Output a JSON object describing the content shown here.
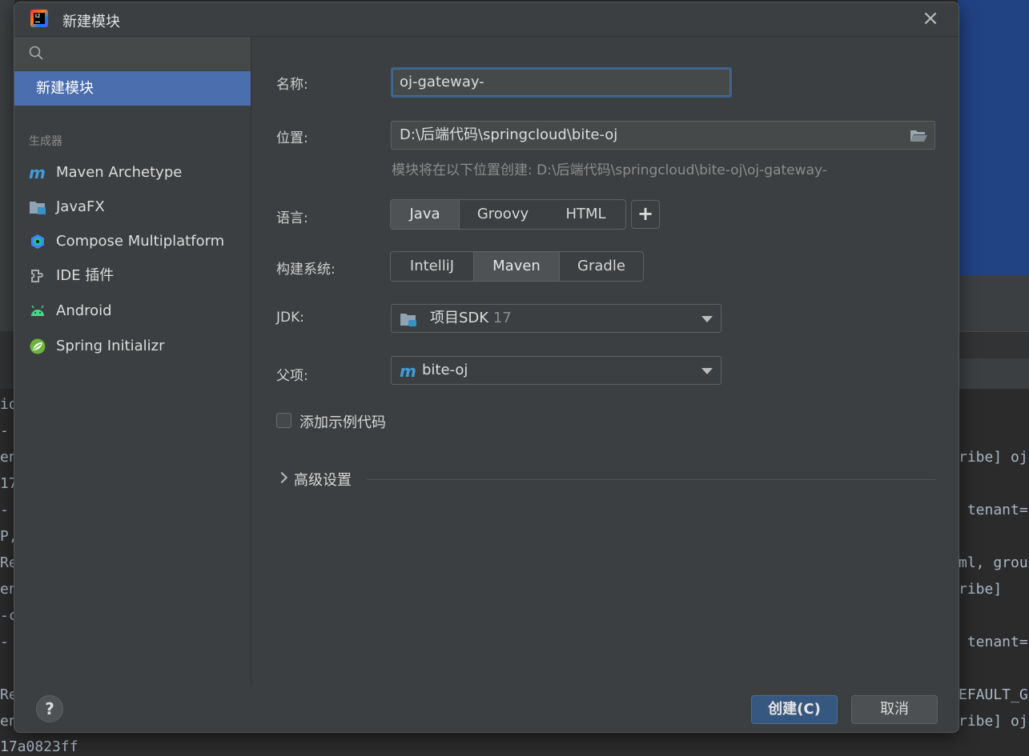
{
  "dialog": {
    "title": "新建模块",
    "close_glyph": "×"
  },
  "sidebar": {
    "search_placeholder": "",
    "selected_item": "新建模块",
    "section_label": "生成器",
    "items": [
      {
        "label": "Maven Archetype",
        "icon": "maven-icon"
      },
      {
        "label": "JavaFX",
        "icon": "javafx-icon"
      },
      {
        "label": "Compose Multiplatform",
        "icon": "compose-icon"
      },
      {
        "label": "IDE 插件",
        "icon": "plugin-icon"
      },
      {
        "label": "Android",
        "icon": "android-icon"
      },
      {
        "label": "Spring Initializr",
        "icon": "spring-icon"
      }
    ]
  },
  "form": {
    "name_label": "名称:",
    "name_value": "oj-gateway-",
    "location_label": "位置:",
    "location_value": "D:\\后端代码\\springcloud\\bite-oj",
    "location_hint": "模块将在以下位置创建: D:\\后端代码\\springcloud\\bite-oj\\oj-gateway-",
    "language_label": "语言:",
    "languages": [
      "Java",
      "Groovy",
      "HTML"
    ],
    "language_selected": "Java",
    "add_language_glyph": "+",
    "build_label": "构建系统:",
    "build_systems": [
      "IntelliJ",
      "Maven",
      "Gradle"
    ],
    "build_selected": "Maven",
    "jdk_label": "JDK:",
    "jdk_value": "项目SDK",
    "jdk_version": "17",
    "parent_label": "父项:",
    "parent_value": "bite-oj",
    "sample_code_label": "添加示例代码",
    "sample_code_checked": false,
    "advanced_label": "高级设置"
  },
  "footer": {
    "help_glyph": "?",
    "create_label": "创建(C)",
    "cancel_label": "取消"
  },
  "background": {
    "console_left": [
      "io",
      "-",
      "en",
      "17",
      "-",
      "P,",
      "Re",
      "en",
      "-c",
      "-",
      "",
      "Re",
      "en"
    ],
    "console_right": [
      "",
      "",
      "ribe] oj",
      "",
      " tenant=",
      "",
      "ml, grou",
      "ribe]",
      "",
      " tenant=",
      "",
      "EFAULT_G",
      "ribe] oj"
    ],
    "console_bottom": "17a0823ff"
  },
  "colors": {
    "accent_selected": "#4b6eaf",
    "primary_button": "#365880",
    "dialog_bg": "#3c3f41"
  }
}
